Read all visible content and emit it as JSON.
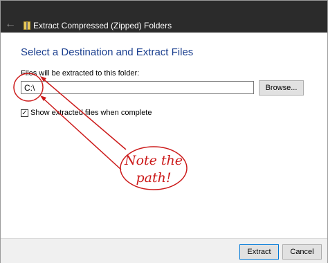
{
  "window": {
    "title": "Extract Compressed (Zipped) Folders",
    "back_icon": "arrow-left-icon",
    "folder_icon": "zipped-folder-icon"
  },
  "main": {
    "heading": "Select a Destination and Extract Files",
    "path_label": "Files will be extracted to this folder:",
    "path_value": "C:\\",
    "browse_label": "Browse...",
    "show_files_label": "Show extracted files when complete",
    "show_files_checked": true
  },
  "annotation": {
    "line1": "Note the",
    "line2": "path!",
    "color": "#cc1a1a"
  },
  "footer": {
    "extract_label": "Extract",
    "cancel_label": "Cancel"
  },
  "colors": {
    "titlebar": "#2b2b2b",
    "heading": "#1b3f8f",
    "accent": "#0078d7"
  }
}
